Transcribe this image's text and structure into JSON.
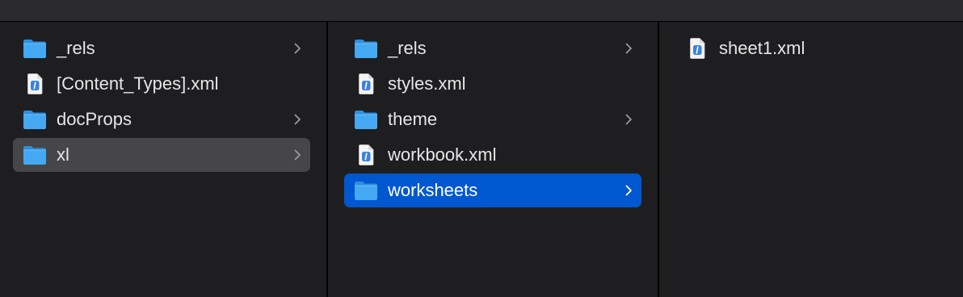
{
  "columns": [
    {
      "items": [
        {
          "label": "_rels",
          "kind": "folder",
          "icon": "folder-icon",
          "has_children": true,
          "state": "none"
        },
        {
          "label": "[Content_Types].xml",
          "kind": "file",
          "icon": "xml-file-icon",
          "has_children": false,
          "state": "none"
        },
        {
          "label": "docProps",
          "kind": "folder",
          "icon": "folder-icon",
          "has_children": true,
          "state": "none"
        },
        {
          "label": "xl",
          "kind": "folder",
          "icon": "folder-icon",
          "has_children": true,
          "state": "selected-inactive"
        }
      ]
    },
    {
      "items": [
        {
          "label": "_rels",
          "kind": "folder",
          "icon": "folder-icon",
          "has_children": true,
          "state": "none"
        },
        {
          "label": "styles.xml",
          "kind": "file",
          "icon": "xml-file-icon",
          "has_children": false,
          "state": "none"
        },
        {
          "label": "theme",
          "kind": "folder",
          "icon": "folder-icon",
          "has_children": true,
          "state": "none"
        },
        {
          "label": "workbook.xml",
          "kind": "file",
          "icon": "xml-file-icon",
          "has_children": false,
          "state": "none"
        },
        {
          "label": "worksheets",
          "kind": "folder",
          "icon": "folder-icon",
          "has_children": true,
          "state": "selected-active"
        }
      ]
    },
    {
      "items": [
        {
          "label": "sheet1.xml",
          "kind": "file",
          "icon": "xml-file-icon",
          "has_children": false,
          "state": "none"
        }
      ]
    }
  ],
  "colors": {
    "background": "#1e1e20",
    "toolbar": "#2b2b2d",
    "selection_active": "#0058d0",
    "selection_inactive": "#464649",
    "folder": "#43a7f0",
    "text": "#e6e6e6"
  }
}
